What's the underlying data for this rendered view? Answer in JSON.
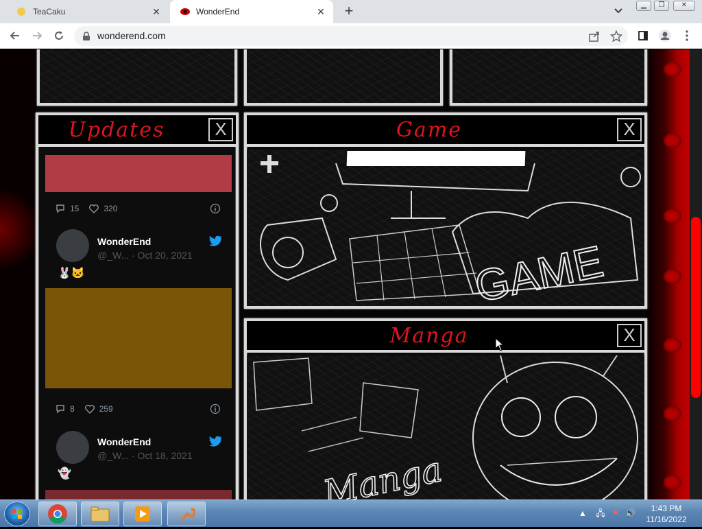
{
  "browser": {
    "tabs": [
      {
        "title": "TeaCaku",
        "active": false
      },
      {
        "title": "WonderEnd",
        "active": true
      }
    ],
    "url": "wonderend.com"
  },
  "panels": {
    "updates": {
      "title": "Updates",
      "close": "X"
    },
    "game": {
      "title": "Game",
      "close": "X",
      "art_text": "GAME"
    },
    "manga": {
      "title": "Manga",
      "close": "X",
      "art_text": "Manga"
    }
  },
  "feed": {
    "tweets": [
      {
        "replies": "15",
        "likes": "320",
        "media_color": "#b13c45"
      },
      {
        "name": "WonderEnd",
        "handle": "@_W...",
        "date": "· Oct 20, 2021",
        "emoji": "🐰🐱",
        "replies": "8",
        "likes": "259",
        "media_color": "#7a5508"
      },
      {
        "name": "WonderEnd",
        "handle": "@_W...",
        "date": "· Oct 18, 2021",
        "emoji": "👻",
        "media_color": "#7a2a2e"
      }
    ]
  },
  "taskbar": {
    "time": "1:43 PM",
    "date": "11/16/2022"
  },
  "colors": {
    "accent_red": "#e0141e",
    "scrollbar": "#ff0000",
    "twitter_blue": "#1d9bf0"
  }
}
